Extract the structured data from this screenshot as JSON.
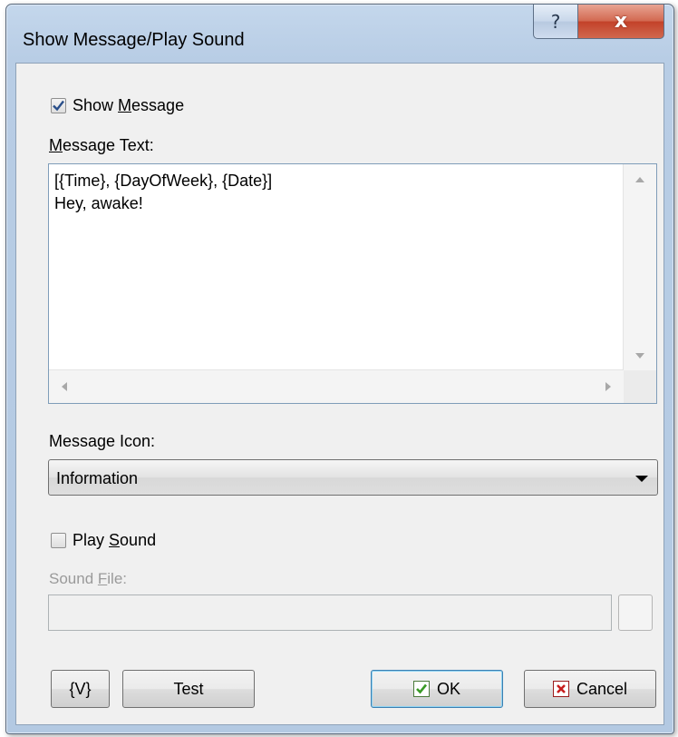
{
  "window": {
    "title": "Show Message/Play Sound",
    "help_glyph": "?",
    "close_glyph": "x"
  },
  "show_message": {
    "label_pre": "Show ",
    "label_accel": "M",
    "label_post": "essage",
    "checked": true
  },
  "message_text": {
    "label_accel": "M",
    "label_post": "essage Text:",
    "value_line1": "[{Time}, {DayOfWeek}, {Date}]",
    "value_line2": "Hey, awake!"
  },
  "message_icon": {
    "label": "Message Icon:",
    "selected": "Information"
  },
  "play_sound": {
    "label_pre": "Play ",
    "label_accel": "S",
    "label_post": "ound",
    "checked": false
  },
  "sound_file": {
    "label_pre": "Sound ",
    "label_accel": "F",
    "label_post": "ile:",
    "value": ""
  },
  "buttons": {
    "variables": "{V}",
    "test": "Test",
    "ok": "OK",
    "cancel": "Cancel"
  },
  "icons": {
    "check": "checkmark-icon",
    "ok": "green-check-icon",
    "cancel": "red-x-icon"
  },
  "colors": {
    "ok_icon": "#3a9a26",
    "cancel_icon": "#c81e1e",
    "default_button_border": "#3c7fb1"
  }
}
